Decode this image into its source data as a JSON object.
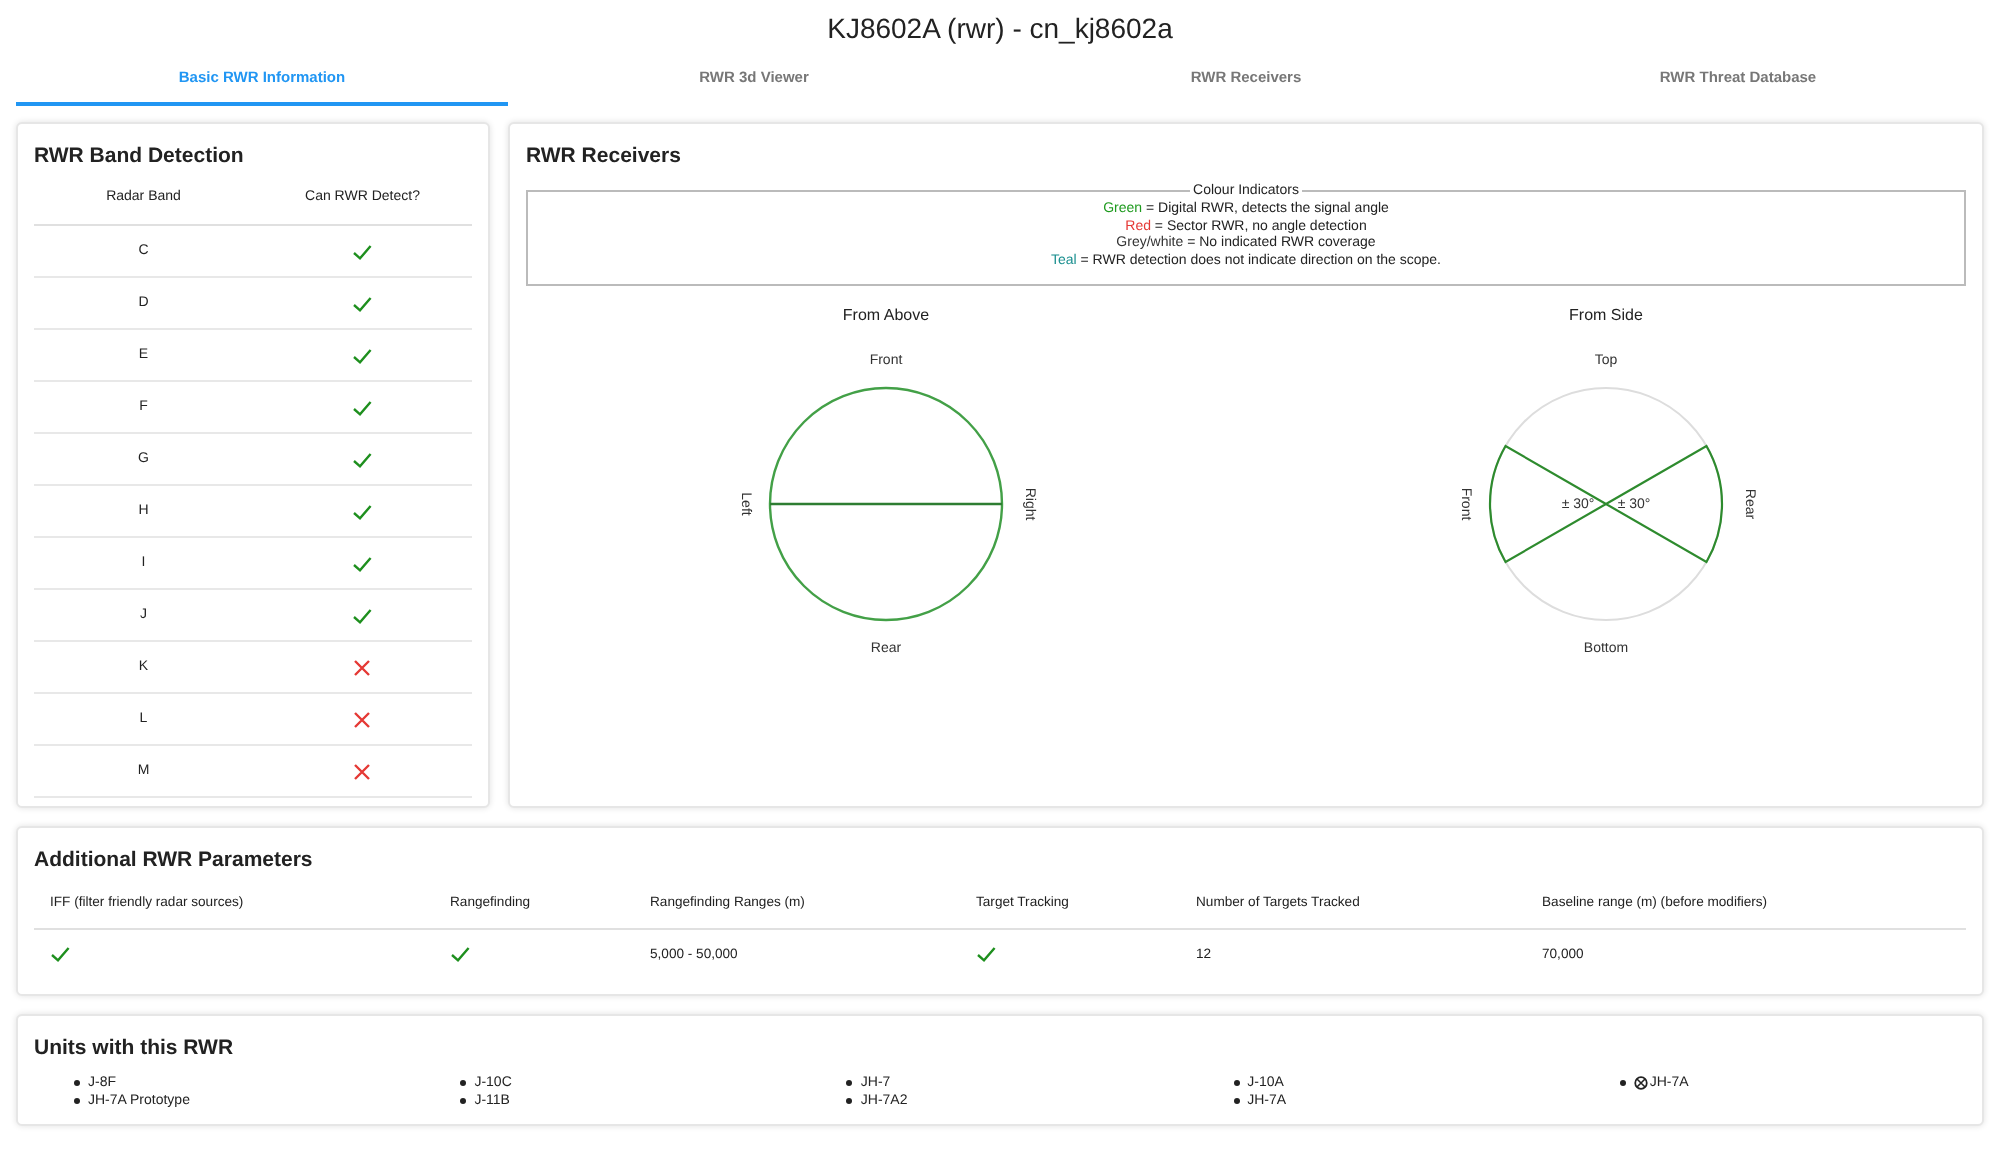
{
  "page_title": "KJ8602A (rwr) - cn_kj8602a",
  "tabs": [
    {
      "label": "Basic RWR Information",
      "selected": true
    },
    {
      "label": "RWR 3d Viewer",
      "selected": false
    },
    {
      "label": "RWR Receivers",
      "selected": false
    },
    {
      "label": "RWR Threat Database",
      "selected": false
    }
  ],
  "band_detection": {
    "title": "RWR Band Detection",
    "columns": [
      "Radar Band",
      "Can RWR Detect?"
    ],
    "rows": [
      {
        "band": "C",
        "detect": true
      },
      {
        "band": "D",
        "detect": true
      },
      {
        "band": "E",
        "detect": true
      },
      {
        "band": "F",
        "detect": true
      },
      {
        "band": "G",
        "detect": true
      },
      {
        "band": "H",
        "detect": true
      },
      {
        "band": "I",
        "detect": true
      },
      {
        "band": "J",
        "detect": true
      },
      {
        "band": "K",
        "detect": false
      },
      {
        "band": "L",
        "detect": false
      },
      {
        "band": "M",
        "detect": false
      }
    ]
  },
  "receivers": {
    "title": "RWR Receivers",
    "legend": {
      "title": "Colour Indicators",
      "lines": [
        {
          "key": "Green",
          "color": "#1e9a1e",
          "text": "= Digital RWR, detects the signal angle"
        },
        {
          "key": "Red",
          "color": "#e53935",
          "text": "= Sector RWR, no angle detection"
        },
        {
          "key": "Grey/white",
          "color": "#333333",
          "text": "= No indicated RWR coverage"
        },
        {
          "key": "Teal",
          "color": "#1a8f8f",
          "text": "= RWR detection does not indicate direction on the scope."
        }
      ]
    },
    "diagrams": [
      {
        "title": "From Above",
        "kind": "above",
        "top": "Front",
        "left": "Left",
        "right": "Right",
        "bottom": "Rear"
      },
      {
        "title": "From Side",
        "kind": "side",
        "top": "Top",
        "left": "Front",
        "right": "Rear",
        "bottom": "Bottom",
        "sector_labels": [
          "± 30°",
          "± 30°"
        ]
      }
    ]
  },
  "parameters": {
    "title": "Additional RWR Parameters",
    "columns": [
      "IFF (filter friendly radar sources)",
      "Rangefinding",
      "Rangefinding Ranges (m)",
      "Target Tracking",
      "Number of Targets Tracked",
      "Baseline range (m) (before modifiers)"
    ],
    "cells": [
      {
        "kind": "check",
        "checked": true
      },
      {
        "kind": "check",
        "checked": true
      },
      {
        "kind": "text",
        "text": "5,000 - 50,000"
      },
      {
        "kind": "check",
        "checked": true
      },
      {
        "kind": "text",
        "text": "12"
      },
      {
        "kind": "text",
        "text": "70,000"
      }
    ]
  },
  "units": {
    "title": "Units with this RWR",
    "columns": [
      [
        {
          "name": "J-8F",
          "flagged": false
        },
        {
          "name": "JH-7A Prototype",
          "flagged": false
        }
      ],
      [
        {
          "name": "J-10C",
          "flagged": false
        },
        {
          "name": "J-11B",
          "flagged": false
        }
      ],
      [
        {
          "name": "JH-7",
          "flagged": false
        },
        {
          "name": "JH-7A2",
          "flagged": false
        }
      ],
      [
        {
          "name": "J-10A",
          "flagged": false
        },
        {
          "name": "JH-7A",
          "flagged": false
        }
      ],
      [
        {
          "name": "JH-7A",
          "flagged": true
        }
      ]
    ]
  }
}
